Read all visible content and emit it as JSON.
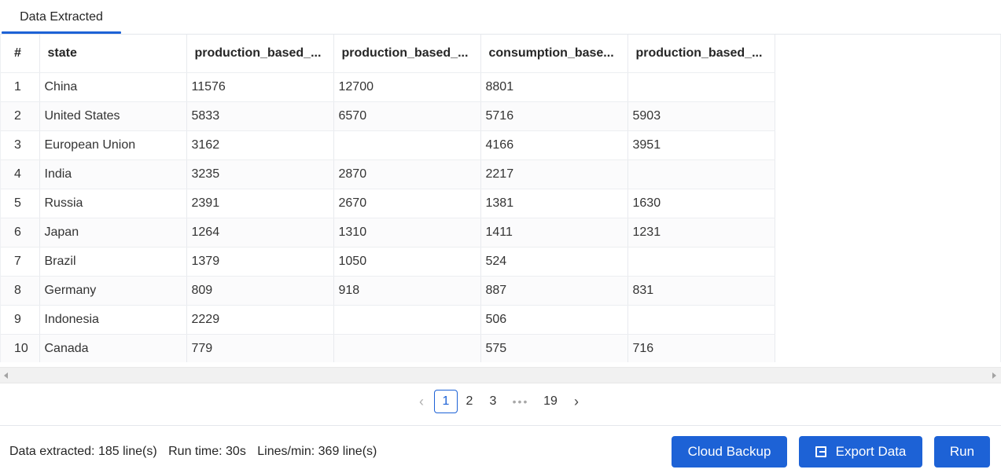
{
  "tabs": [
    {
      "label": "Data Extracted"
    }
  ],
  "table": {
    "columns": [
      "#",
      "state",
      "production_based_...",
      "production_based_...",
      "consumption_base...",
      "production_based_..."
    ],
    "rows": [
      [
        "1",
        "China",
        "11576",
        "12700",
        "8801",
        ""
      ],
      [
        "2",
        "United States",
        "5833",
        "6570",
        "5716",
        "5903"
      ],
      [
        "3",
        "European Union",
        "3162",
        "",
        "4166",
        "3951"
      ],
      [
        "4",
        "India",
        "3235",
        "2870",
        "2217",
        ""
      ],
      [
        "5",
        "Russia",
        "2391",
        "2670",
        "1381",
        "1630"
      ],
      [
        "6",
        "Japan",
        "1264",
        "1310",
        "1411",
        "1231"
      ],
      [
        "7",
        "Brazil",
        "1379",
        "1050",
        "524",
        ""
      ],
      [
        "8",
        "Germany",
        "809",
        "918",
        "887",
        "831"
      ],
      [
        "9",
        "Indonesia",
        "2229",
        "",
        "506",
        ""
      ],
      [
        "10",
        "Canada",
        "779",
        "",
        "575",
        "716"
      ]
    ]
  },
  "pagination": {
    "prev_icon": "chevron-left-icon",
    "pages": [
      "1",
      "2",
      "3"
    ],
    "ellipsis": "•••",
    "last_page": "19",
    "next_icon": "chevron-right-icon",
    "current": "1"
  },
  "status": {
    "extracted": "Data extracted: 185 line(s)",
    "run_time": "Run time: 30s",
    "rate": "Lines/min: 369 line(s)"
  },
  "actions": {
    "cloud_backup": "Cloud Backup",
    "export": "Export Data",
    "export_icon": "export-icon",
    "run": "Run"
  },
  "colors": {
    "accent": "#1d62d6",
    "text": "#262626"
  }
}
